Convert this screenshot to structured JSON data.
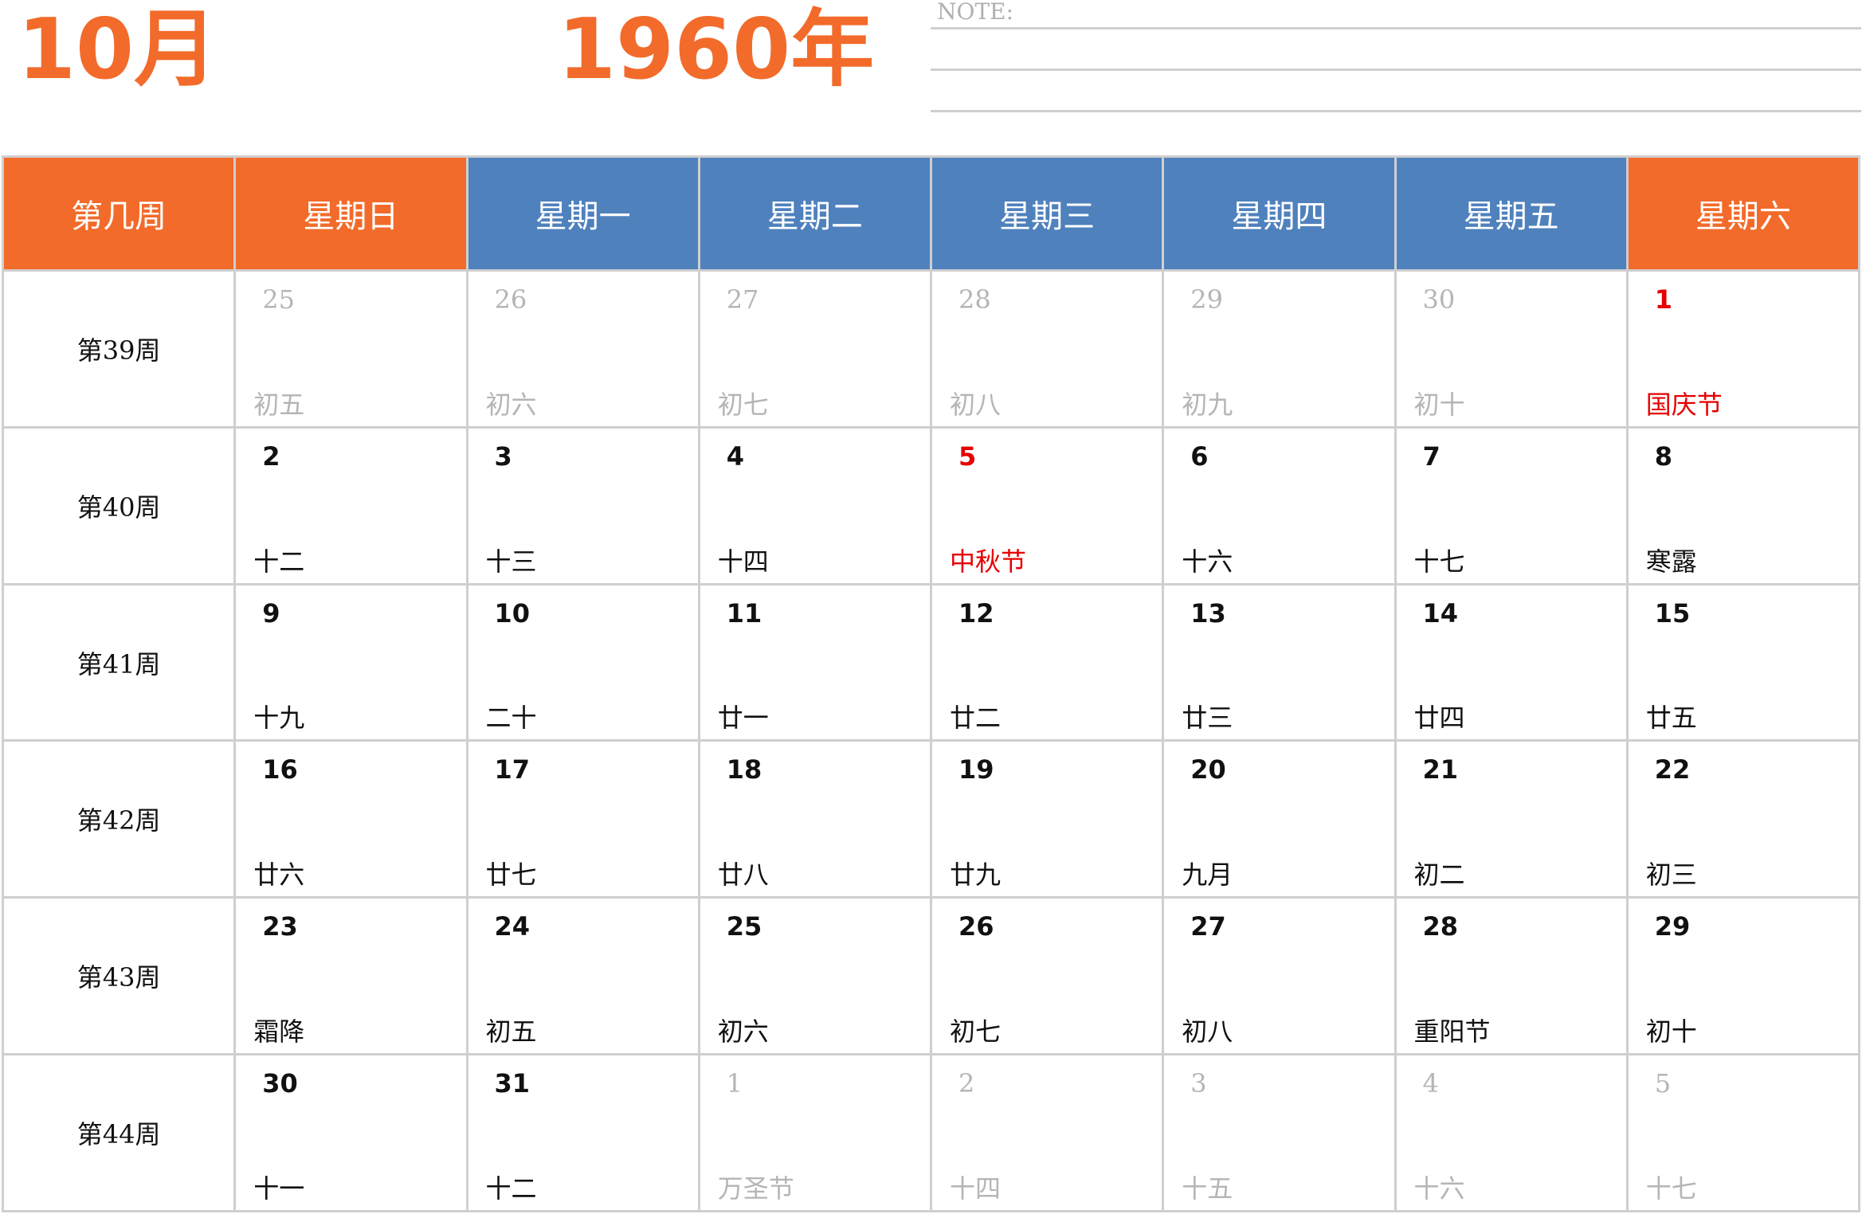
{
  "header": {
    "month": "10月",
    "year": "1960年",
    "note_label": "NOTE:"
  },
  "colors": {
    "accent_orange": "#F26B2A",
    "accent_blue": "#4F81BD",
    "holiday_red": "#E60000",
    "muted_gray": "#B5B5B5"
  },
  "calendar": {
    "headers": [
      {
        "label": "第几周",
        "style": "orange"
      },
      {
        "label": "星期日",
        "style": "orange"
      },
      {
        "label": "星期一",
        "style": "blue"
      },
      {
        "label": "星期二",
        "style": "blue"
      },
      {
        "label": "星期三",
        "style": "blue"
      },
      {
        "label": "星期四",
        "style": "blue"
      },
      {
        "label": "星期五",
        "style": "blue"
      },
      {
        "label": "星期六",
        "style": "orange"
      }
    ],
    "weeks": [
      {
        "label": "第39周",
        "days": [
          {
            "day": "25",
            "lunar": "初五",
            "other": true
          },
          {
            "day": "26",
            "lunar": "初六",
            "other": true
          },
          {
            "day": "27",
            "lunar": "初七",
            "other": true
          },
          {
            "day": "28",
            "lunar": "初八",
            "other": true
          },
          {
            "day": "29",
            "lunar": "初九",
            "other": true
          },
          {
            "day": "30",
            "lunar": "初十",
            "other": true
          },
          {
            "day": "1",
            "lunar": "国庆节",
            "holiday": true,
            "holiday_label": true
          }
        ]
      },
      {
        "label": "第40周",
        "days": [
          {
            "day": "2",
            "lunar": "十二"
          },
          {
            "day": "3",
            "lunar": "十三"
          },
          {
            "day": "4",
            "lunar": "十四"
          },
          {
            "day": "5",
            "lunar": "中秋节",
            "holiday": true,
            "holiday_label": true
          },
          {
            "day": "6",
            "lunar": "十六"
          },
          {
            "day": "7",
            "lunar": "十七"
          },
          {
            "day": "8",
            "lunar": "寒露"
          }
        ]
      },
      {
        "label": "第41周",
        "days": [
          {
            "day": "9",
            "lunar": "十九"
          },
          {
            "day": "10",
            "lunar": "二十"
          },
          {
            "day": "11",
            "lunar": "廿一"
          },
          {
            "day": "12",
            "lunar": "廿二"
          },
          {
            "day": "13",
            "lunar": "廿三"
          },
          {
            "day": "14",
            "lunar": "廿四"
          },
          {
            "day": "15",
            "lunar": "廿五"
          }
        ]
      },
      {
        "label": "第42周",
        "days": [
          {
            "day": "16",
            "lunar": "廿六"
          },
          {
            "day": "17",
            "lunar": "廿七"
          },
          {
            "day": "18",
            "lunar": "廿八"
          },
          {
            "day": "19",
            "lunar": "廿九"
          },
          {
            "day": "20",
            "lunar": "九月"
          },
          {
            "day": "21",
            "lunar": "初二"
          },
          {
            "day": "22",
            "lunar": "初三"
          }
        ]
      },
      {
        "label": "第43周",
        "days": [
          {
            "day": "23",
            "lunar": "霜降"
          },
          {
            "day": "24",
            "lunar": "初五"
          },
          {
            "day": "25",
            "lunar": "初六"
          },
          {
            "day": "26",
            "lunar": "初七"
          },
          {
            "day": "27",
            "lunar": "初八"
          },
          {
            "day": "28",
            "lunar": "重阳节"
          },
          {
            "day": "29",
            "lunar": "初十"
          }
        ]
      },
      {
        "label": "第44周",
        "days": [
          {
            "day": "30",
            "lunar": "十一"
          },
          {
            "day": "31",
            "lunar": "十二"
          },
          {
            "day": "1",
            "lunar": "万圣节",
            "other": true
          },
          {
            "day": "2",
            "lunar": "十四",
            "other": true
          },
          {
            "day": "3",
            "lunar": "十五",
            "other": true
          },
          {
            "day": "4",
            "lunar": "十六",
            "other": true
          },
          {
            "day": "5",
            "lunar": "十七",
            "other": true
          }
        ]
      }
    ]
  }
}
